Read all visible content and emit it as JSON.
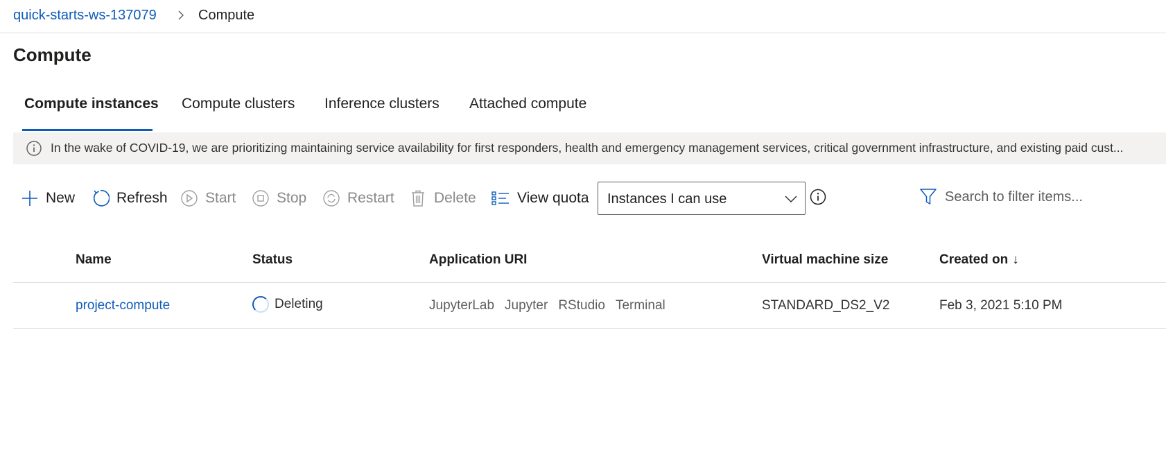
{
  "breadcrumb": {
    "workspace": "quick-starts-ws-137079",
    "current": "Compute"
  },
  "page": {
    "title": "Compute"
  },
  "tabs": [
    {
      "label": "Compute instances",
      "active": true
    },
    {
      "label": "Compute clusters",
      "active": false
    },
    {
      "label": "Inference clusters",
      "active": false
    },
    {
      "label": "Attached compute",
      "active": false
    }
  ],
  "banner": {
    "icon": "info-icon",
    "text": "In the wake of COVID-19, we are prioritizing maintaining service availability for first responders, health and emergency management services, critical government infrastructure, and existing paid cust..."
  },
  "toolbar": {
    "new": "New",
    "refresh": "Refresh",
    "start": "Start",
    "stop": "Stop",
    "restart": "Restart",
    "delete": "Delete",
    "view_quota": "View quota"
  },
  "filter": {
    "selected": "Instances I can use"
  },
  "search": {
    "placeholder": "Search to filter items..."
  },
  "table": {
    "columns": [
      "Name",
      "Status",
      "Application URI",
      "Virtual machine size",
      "Created on"
    ],
    "sort_indicator": "↓",
    "rows": [
      {
        "name": "project-compute",
        "status": "Deleting",
        "uris": [
          "JupyterLab",
          "Jupyter",
          "RStudio",
          "Terminal"
        ],
        "vm_size": "STANDARD_DS2_V2",
        "created_on": "Feb 3, 2021 5:10 PM"
      }
    ]
  },
  "colors": {
    "link": "#0f5cb8",
    "disabled": "#8a8886",
    "banner_bg": "#f3f2f1"
  }
}
